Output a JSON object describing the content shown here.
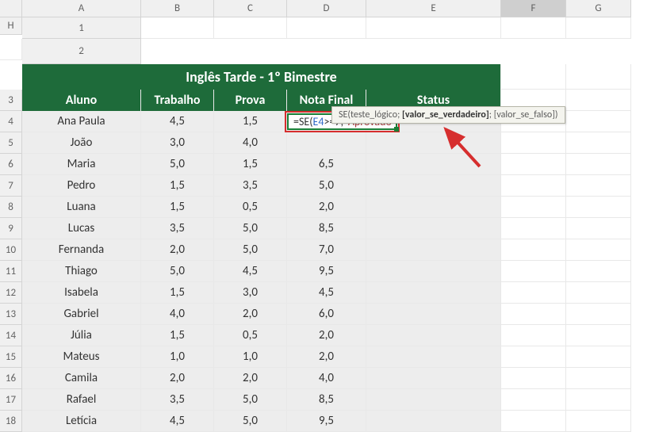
{
  "columns": [
    "A",
    "B",
    "C",
    "D",
    "E",
    "F",
    "G",
    "H"
  ],
  "rows": [
    "1",
    "2",
    "3",
    "4",
    "5",
    "6",
    "7",
    "8",
    "9",
    "10",
    "11",
    "12",
    "13",
    "14",
    "15",
    "16",
    "17",
    "18"
  ],
  "title": "Inglês Tarde - 1º Bimestre",
  "headers": {
    "aluno": "Aluno",
    "trabalho": "Trabalho",
    "prova": "Prova",
    "notafinal": "Nota Final",
    "status": "Status"
  },
  "formula": {
    "eq": "=",
    "fn": "SE(",
    "ref": "E4",
    "mid": ">=7;",
    "str": "\"Aprovado\""
  },
  "tooltip": {
    "fn": "SE(",
    "a1": "teste_lógico",
    "sep1": "; ",
    "a2": "[valor_se_verdadeiro]",
    "sep2": "; ",
    "a3": "[valor_se_falso]",
    "close": ")"
  },
  "students": [
    {
      "name": "Ana Paula",
      "trab": "4,5",
      "prova": "1,5",
      "final": ""
    },
    {
      "name": "João",
      "trab": "3,0",
      "prova": "4,0",
      "final": ""
    },
    {
      "name": "Maria",
      "trab": "5,0",
      "prova": "1,5",
      "final": "6,5"
    },
    {
      "name": "Pedro",
      "trab": "1,5",
      "prova": "3,5",
      "final": "5,0"
    },
    {
      "name": "Luana",
      "trab": "1,5",
      "prova": "0,5",
      "final": "2,0"
    },
    {
      "name": "Lucas",
      "trab": "3,5",
      "prova": "5,0",
      "final": "8,5"
    },
    {
      "name": "Fernanda",
      "trab": "2,0",
      "prova": "5,0",
      "final": "7,0"
    },
    {
      "name": "Thiago",
      "trab": "5,0",
      "prova": "4,5",
      "final": "9,5"
    },
    {
      "name": "Isabela",
      "trab": "1,5",
      "prova": "3,0",
      "final": "4,5"
    },
    {
      "name": "Gabriel",
      "trab": "4,0",
      "prova": "2,0",
      "final": "6,0"
    },
    {
      "name": "Júlia",
      "trab": "1,5",
      "prova": "0,5",
      "final": "2,0"
    },
    {
      "name": "Mateus",
      "trab": "1,0",
      "prova": "1,0",
      "final": "2,0"
    },
    {
      "name": "Camila",
      "trab": "2,0",
      "prova": "2,0",
      "final": "4,0"
    },
    {
      "name": "Rafael",
      "trab": "3,5",
      "prova": "5,0",
      "final": "8,5"
    },
    {
      "name": "Letícia",
      "trab": "4,5",
      "prova": "5,0",
      "final": "9,5"
    }
  ],
  "chart_data": {
    "type": "table",
    "title": "Inglês Tarde - 1º Bimestre",
    "columns": [
      "Aluno",
      "Trabalho",
      "Prova",
      "Nota Final",
      "Status"
    ],
    "rows": [
      [
        "Ana Paula",
        4.5,
        1.5,
        null,
        null
      ],
      [
        "João",
        3.0,
        4.0,
        null,
        null
      ],
      [
        "Maria",
        5.0,
        1.5,
        6.5,
        null
      ],
      [
        "Pedro",
        1.5,
        3.5,
        5.0,
        null
      ],
      [
        "Luana",
        1.5,
        0.5,
        2.0,
        null
      ],
      [
        "Lucas",
        3.5,
        5.0,
        8.5,
        null
      ],
      [
        "Fernanda",
        2.0,
        5.0,
        7.0,
        null
      ],
      [
        "Thiago",
        5.0,
        4.5,
        9.5,
        null
      ],
      [
        "Isabela",
        1.5,
        3.0,
        4.5,
        null
      ],
      [
        "Gabriel",
        4.0,
        2.0,
        6.0,
        null
      ],
      [
        "Júlia",
        1.5,
        0.5,
        2.0,
        null
      ],
      [
        "Mateus",
        1.0,
        1.0,
        2.0,
        null
      ],
      [
        "Camila",
        2.0,
        2.0,
        4.0,
        null
      ],
      [
        "Rafael",
        3.5,
        5.0,
        8.5,
        null
      ],
      [
        "Letícia",
        4.5,
        5.0,
        9.5,
        null
      ]
    ]
  }
}
